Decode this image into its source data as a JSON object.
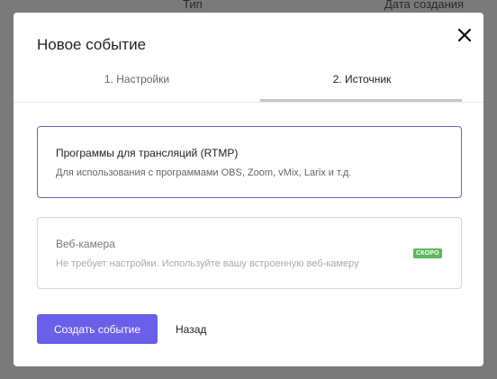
{
  "background": {
    "columns": {
      "type": "Тип",
      "date_created": "Дата создания"
    }
  },
  "dialog": {
    "title": "Новое событие",
    "close_icon": "close-icon",
    "tabs": [
      {
        "label": "1. Настройки",
        "active": false
      },
      {
        "label": "2. Источник",
        "active": true
      }
    ],
    "options": [
      {
        "title": "Программы для трансляций (RTMP)",
        "description": "Для использования с программами OBS, Zoom, vMix, Larix и т.д.",
        "selected": true,
        "disabled": false
      },
      {
        "title": "Веб-камера",
        "description": "Не требует настройки. Используйте вашу встроенную веб-камеру",
        "badge": "СКОРО",
        "selected": false,
        "disabled": true
      }
    ],
    "buttons": {
      "create": "Создать событие",
      "back": "Назад"
    }
  },
  "colors": {
    "accent": "#6a5fe8",
    "selected_border": "#6a60c8",
    "badge": "#5cb85c"
  }
}
